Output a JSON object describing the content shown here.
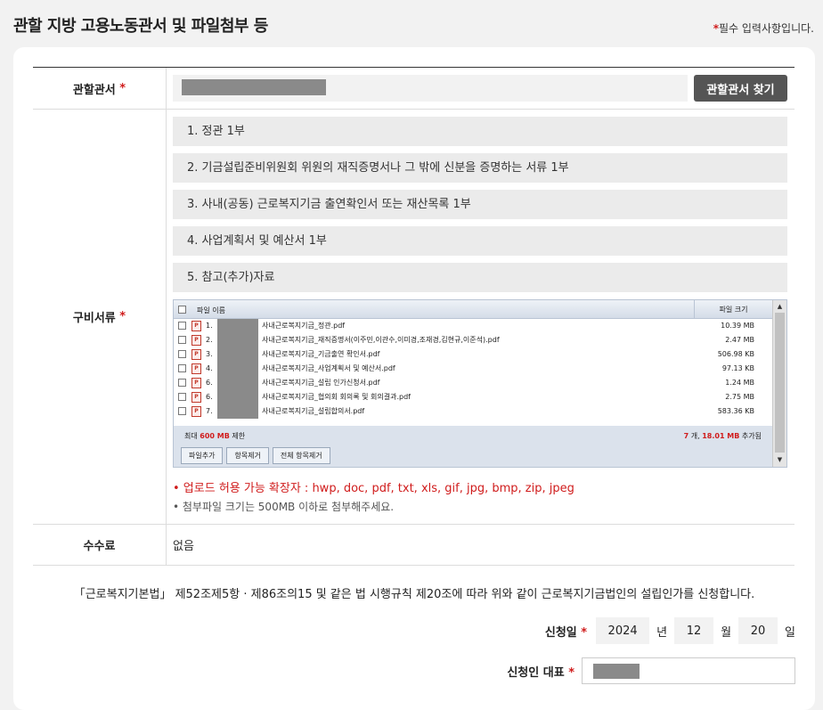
{
  "page": {
    "title": "관할 지방 고용노동관서 및 파일첨부 등",
    "required_note": "필수 입력사항입니다.",
    "required_mark": "*"
  },
  "office": {
    "label": "관할관서",
    "find_button": "관할관서 찾기"
  },
  "docs": {
    "label": "구비서류",
    "items": [
      "1. 정관 1부",
      "2. 기금설립준비위원회 위원의 재직증명서나 그 밖에 신분을 증명하는 서류 1부",
      "3. 사내(공동) 근로복지기금 출연확인서 또는 재산목록 1부",
      "4. 사업계획서 및 예산서 1부",
      "5. 참고(추가)자료"
    ]
  },
  "uploader": {
    "col_name": "파일 이름",
    "col_size": "파일 크기",
    "files": [
      {
        "num": "1.",
        "name": "사내근로복지기금_정관.pdf",
        "size": "10.39 MB"
      },
      {
        "num": "2.",
        "name": "사내근로복지기금_재직증명서(이주민,이관수,이미경,조재경,김현규,이준석).pdf",
        "size": "2.47 MB"
      },
      {
        "num": "3.",
        "name": "사내근로복지기금_기금출연 확인서.pdf",
        "size": "506.98 KB"
      },
      {
        "num": "4.",
        "name": "사내근로복지기금_사업계획서 및 예산서.pdf",
        "size": "97.13 KB"
      },
      {
        "num": "6.",
        "name": "사내근로복지기금_설립 인가신청서.pdf",
        "size": "1.24 MB"
      },
      {
        "num": "6.",
        "name": "사내근로복지기금_협의회 회의록 및 회의결과.pdf",
        "size": "2.75 MB"
      },
      {
        "num": "7.",
        "name": "사내근로복지기금_설립합의서.pdf",
        "size": "583.36 KB"
      }
    ],
    "limit_prefix": "최대",
    "limit_value": "600 MB",
    "limit_suffix": "제한",
    "count_value": "7",
    "count_unit": "개,",
    "total_value": "18.01 MB",
    "total_suffix": "추가됨",
    "btn_add": "파일추가",
    "btn_remove": "항목제거",
    "btn_remove_all": "전체 항목제거"
  },
  "notes": {
    "allowed_ext": "• 업로드 허용 가능 확장자 : hwp, doc, pdf, txt, xls, gif, jpg, bmp, zip, jpeg",
    "size_limit": "• 첨부파일 크기는 500MB 이하로 첨부해주세요."
  },
  "fee": {
    "label": "수수료",
    "value": "없음"
  },
  "statement": "「근로복지기본법」 제52조제5항 · 제86조의15 및 같은 법 시행규칙 제20조에 따라 위와 같이 근로복지기금법인의 설립인가를 신청합니다.",
  "date": {
    "label": "신청일",
    "year": "2024",
    "year_unit": "년",
    "month": "12",
    "month_unit": "월",
    "day": "20",
    "day_unit": "일"
  },
  "applicant": {
    "label": "신청인 대표"
  },
  "colors": {
    "accent_red": "#d01c1c",
    "button_dark": "#555555"
  }
}
